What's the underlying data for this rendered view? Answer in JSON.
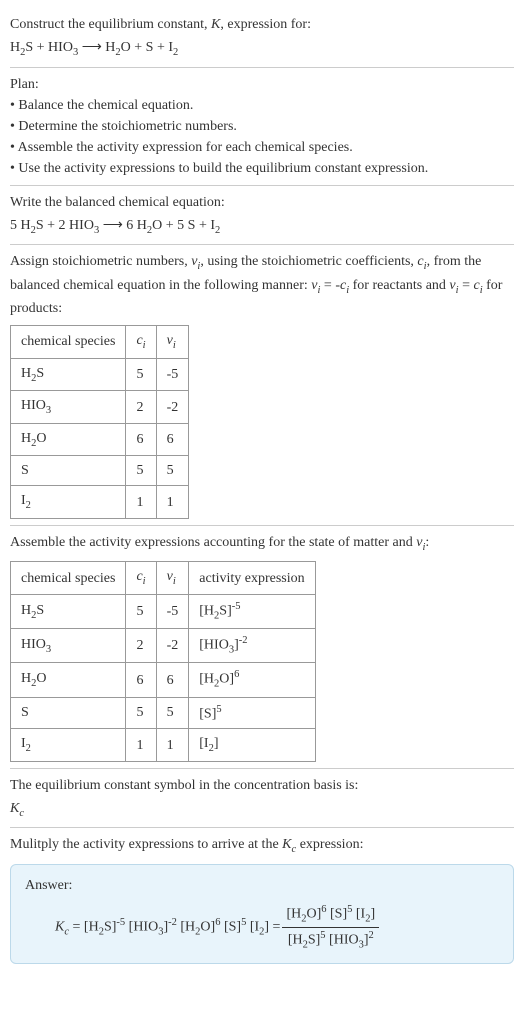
{
  "chart_data": [
    {
      "type": "table",
      "title": "Stoichiometric numbers",
      "columns": [
        "chemical species",
        "c_i",
        "ν_i"
      ],
      "rows": [
        [
          "H2S",
          5,
          -5
        ],
        [
          "HIO3",
          2,
          -2
        ],
        [
          "H2O",
          6,
          6
        ],
        [
          "S",
          5,
          5
        ],
        [
          "I2",
          1,
          1
        ]
      ]
    },
    {
      "type": "table",
      "title": "Activity expressions",
      "columns": [
        "chemical species",
        "c_i",
        "ν_i",
        "activity expression"
      ],
      "rows": [
        [
          "H2S",
          5,
          -5,
          "[H2S]^-5"
        ],
        [
          "HIO3",
          2,
          -2,
          "[HIO3]^-2"
        ],
        [
          "H2O",
          6,
          6,
          "[H2O]^6"
        ],
        [
          "S",
          5,
          5,
          "[S]^5"
        ],
        [
          "I2",
          1,
          1,
          "[I2]"
        ]
      ]
    }
  ],
  "intro": {
    "line1a": "Construct the equilibrium constant, ",
    "line1K": "K",
    "line1b": ", expression for:",
    "eq_lhs1": "H",
    "eq_lhs1_s": "2",
    "eq_lhs1b": "S + HIO",
    "eq_lhs1_s2": "3",
    "arrow": " ⟶ ",
    "eq_rhs1": "H",
    "eq_rhs1_s": "2",
    "eq_rhs1b": "O + S + I",
    "eq_rhs1_s2": "2"
  },
  "plan": {
    "title": "Plan:",
    "b1": "• Balance the chemical equation.",
    "b2": "• Determine the stoichiometric numbers.",
    "b3": "• Assemble the activity expression for each chemical species.",
    "b4": "• Use the activity expressions to build the equilibrium constant expression."
  },
  "balanced": {
    "title": "Write the balanced chemical equation:",
    "c1": "5 H",
    "s1": "2",
    "c2": "S + 2 HIO",
    "s2": "3",
    "arrow": " ⟶ ",
    "c3": "6 H",
    "s3": "2",
    "c4": "O + 5 S + I",
    "s4": "2"
  },
  "stoich": {
    "text_a": "Assign stoichiometric numbers, ",
    "nu": "ν",
    "sub_i": "i",
    "text_b": ", using the stoichiometric coefficients, ",
    "c": "c",
    "text_c": ", from the balanced chemical equation in the following manner: ",
    "eq1a": "ν",
    "eq1b": " = -",
    "eq1c": "c",
    "text_d": " for reactants and ",
    "eq2a": "ν",
    "eq2b": " = ",
    "eq2c": "c",
    "text_e": " for products:",
    "h1": "chemical species",
    "h2": "c",
    "h3": "ν",
    "r1a": "H",
    "r1s": "2",
    "r1b": "S",
    "r1c": "5",
    "r1n": "-5",
    "r2a": "HIO",
    "r2s": "3",
    "r2c": "2",
    "r2n": "-2",
    "r3a": "H",
    "r3s": "2",
    "r3b": "O",
    "r3c": "6",
    "r3n": "6",
    "r4a": "S",
    "r4c": "5",
    "r4n": "5",
    "r5a": "I",
    "r5s": "2",
    "r5c": "1",
    "r5n": "1"
  },
  "activity": {
    "text_a": "Assemble the activity expressions accounting for the state of matter and ",
    "nu": "ν",
    "sub_i": "i",
    "text_b": ":",
    "h1": "chemical species",
    "h2": "c",
    "h3": "ν",
    "h4": "activity expression",
    "r1sp_a": "H",
    "r1sp_s": "2",
    "r1sp_b": "S",
    "r1c": "5",
    "r1n": "-5",
    "r1ae_a": "[H",
    "r1ae_s": "2",
    "r1ae_b": "S]",
    "r1ae_e": "-5",
    "r2sp_a": "HIO",
    "r2sp_s": "3",
    "r2c": "2",
    "r2n": "-2",
    "r2ae_a": "[HIO",
    "r2ae_s": "3",
    "r2ae_b": "]",
    "r2ae_e": "-2",
    "r3sp_a": "H",
    "r3sp_s": "2",
    "r3sp_b": "O",
    "r3c": "6",
    "r3n": "6",
    "r3ae_a": "[H",
    "r3ae_s": "2",
    "r3ae_b": "O]",
    "r3ae_e": "6",
    "r4sp": "S",
    "r4c": "5",
    "r4n": "5",
    "r4ae_a": "[S]",
    "r4ae_e": "5",
    "r5sp_a": "I",
    "r5sp_s": "2",
    "r5c": "1",
    "r5n": "1",
    "r5ae_a": "[I",
    "r5ae_s": "2",
    "r5ae_b": "]"
  },
  "symbol": {
    "text": "The equilibrium constant symbol in the concentration basis is:",
    "K": "K",
    "c": "c"
  },
  "multiply": {
    "text_a": "Mulitply the activity expressions to arrive at the ",
    "K": "K",
    "c": "c",
    "text_b": " expression:"
  },
  "answer": {
    "label": "Answer:",
    "K": "K",
    "c": "c",
    "eq": " = ",
    "t1a": "[H",
    "t1s": "2",
    "t1b": "S]",
    "t1e": "-5",
    "t2a": " [HIO",
    "t2s": "3",
    "t2b": "]",
    "t2e": "-2",
    "t3a": " [H",
    "t3s": "2",
    "t3b": "O]",
    "t3e": "6",
    "t4a": " [S]",
    "t4e": "5",
    "t5a": " [I",
    "t5s": "2",
    "t5b": "] = ",
    "num_a": "[H",
    "num_s1": "2",
    "num_b": "O]",
    "num_e1": "6",
    "num_c": " [S]",
    "num_e2": "5",
    "num_d": " [I",
    "num_s2": "2",
    "num_e": "]",
    "den_a": "[H",
    "den_s1": "2",
    "den_b": "S]",
    "den_e1": "5",
    "den_c": " [HIO",
    "den_s2": "3",
    "den_d": "]",
    "den_e2": "2"
  }
}
